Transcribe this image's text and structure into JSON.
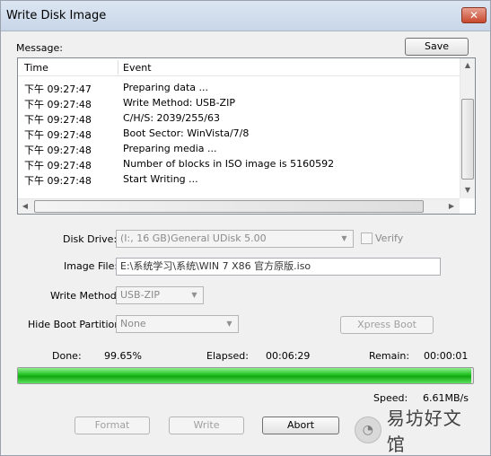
{
  "window": {
    "title": "Write Disk Image",
    "close_glyph": "✕"
  },
  "message": {
    "label": "Message:",
    "save_label": "Save"
  },
  "log": {
    "columns": [
      "Time",
      "Event"
    ],
    "rows": [
      [
        "下午 09:27:47",
        "Preparing data ..."
      ],
      [
        "下午 09:27:48",
        "Write Method: USB-ZIP"
      ],
      [
        "下午 09:27:48",
        "C/H/S: 2039/255/63"
      ],
      [
        "下午 09:27:48",
        "Boot Sector: WinVista/7/8"
      ],
      [
        "下午 09:27:48",
        "Preparing media ..."
      ],
      [
        "下午 09:27:48",
        "Number of blocks in ISO image is 5160592"
      ],
      [
        "下午 09:27:48",
        "Start Writing ..."
      ]
    ]
  },
  "form": {
    "disk_drive_label": "Disk Drive:",
    "disk_drive_value": "(I:, 16 GB)General UDisk          5.00",
    "verify_label": "Verify",
    "image_file_label": "Image File:",
    "image_file_value": "E:\\系统学习\\系统\\WIN 7      X86 官方原版.iso",
    "write_method_label": "Write Method:",
    "write_method_value": "USB-ZIP",
    "hide_boot_label": "Hide Boot Partition:",
    "hide_boot_value": "None",
    "xpress_boot_label": "Xpress Boot"
  },
  "status": {
    "done_label": "Done:",
    "done_value": "99.65%",
    "progress_fraction": 0.9965,
    "elapsed_label": "Elapsed:",
    "elapsed_value": "00:06:29",
    "remain_label": "Remain:",
    "remain_value": "00:00:01",
    "speed_label": "Speed:",
    "speed_value": "6.61MB/s"
  },
  "actions": {
    "format_label": "Format",
    "write_label": "Write",
    "abort_label": "Abort"
  },
  "watermark": {
    "text": "易坊好文馆",
    "logo_glyph": "◔"
  },
  "colors": {
    "progress_green": "#1fbf1f",
    "titlebar": "#dce6f2",
    "close_red": "#c7472c"
  }
}
